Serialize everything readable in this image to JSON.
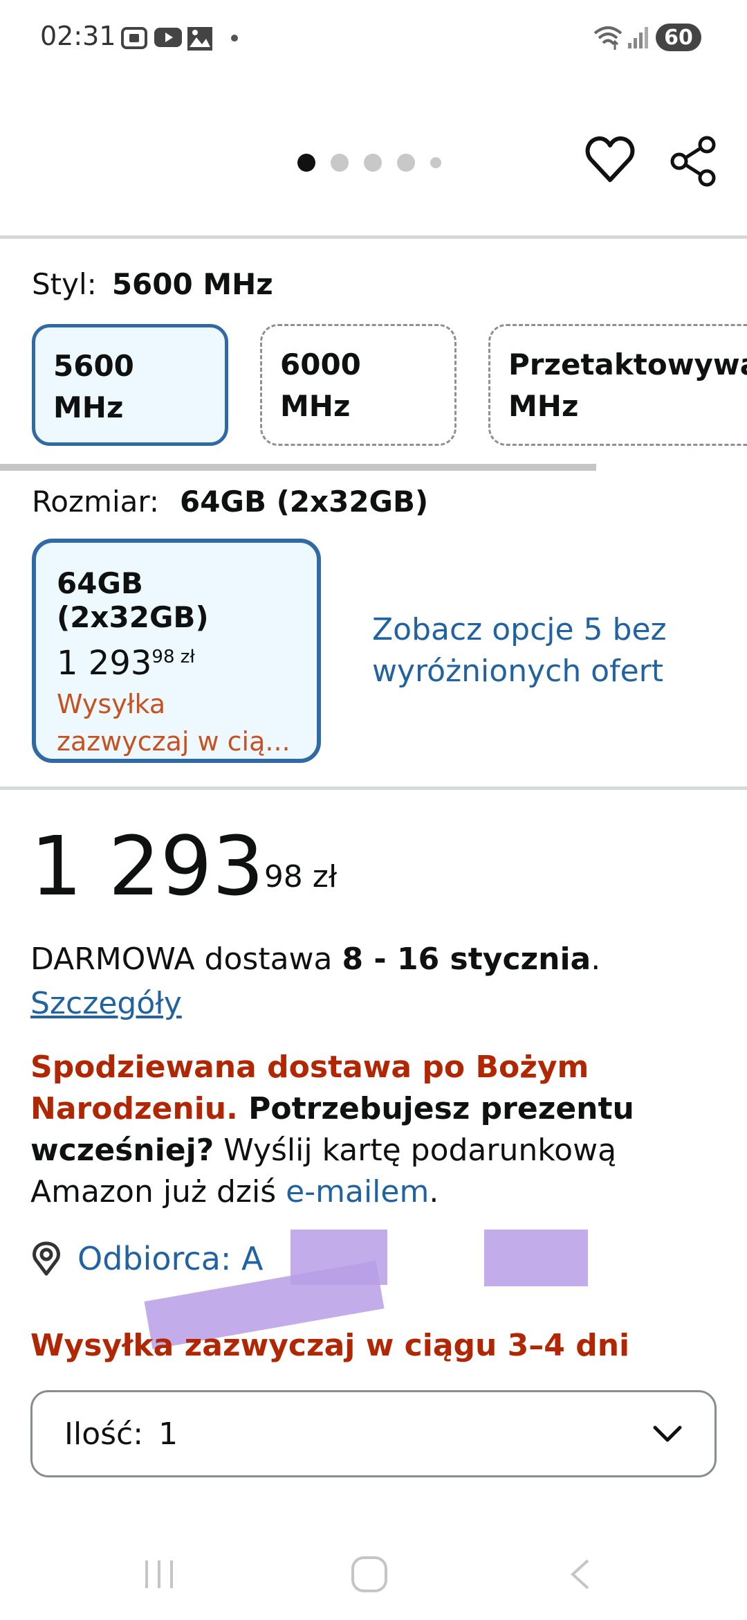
{
  "status_bar": {
    "time": "02:31",
    "battery": "60"
  },
  "carousel": {
    "dot_count": 5,
    "active_index": 0
  },
  "style": {
    "label": "Styl:",
    "value": "5600 MHz",
    "options": [
      {
        "label": "5600 MHz",
        "selected": true
      },
      {
        "label": "6000 MHz",
        "selected": false
      },
      {
        "label": "Przetaktowywa MHz",
        "line1": "Przetaktowywa",
        "line2": "MHz",
        "selected": false
      }
    ]
  },
  "size": {
    "label": "Rozmiar:",
    "value": "64GB (2x32GB)",
    "card": {
      "title": "64GB (2x32GB)",
      "price_main": "1 293",
      "price_sup": "98 zł",
      "ship_line1": "Wysyłka",
      "ship_line2": "zazwyczaj w cią..."
    },
    "other_offers_line1": "Zobacz opcje 5 bez",
    "other_offers_line2": "wyróżnionych ofert"
  },
  "price": {
    "main": "1 293",
    "sup": "98 zł"
  },
  "delivery": {
    "prefix": "DARMOWA dostawa ",
    "dates": "8 - 16 stycznia",
    "suffix": ".",
    "details_link": "Szczegóły"
  },
  "gift": {
    "red1": "Spodziewana dostawa po Bożym",
    "red2": "Narodzeniu.",
    "bold1": " Potrzebujesz prezentu",
    "bold2": "wcześniej?",
    "text1": " Wyślij kartę podarunkową",
    "text2": "Amazon już dziś ",
    "link": "e-mailem",
    "end": "."
  },
  "recipient": {
    "text": "Odbiorca: A"
  },
  "shipping_time": "Wysyłka zazwyczaj w ciągu 3–4 dni",
  "quantity": {
    "label": "Ilość:",
    "value": "1"
  },
  "colors": {
    "link": "#2162a1",
    "alert_red": "#b12704",
    "selected_border": "#2f6aa5",
    "orange": "#c7511f"
  }
}
